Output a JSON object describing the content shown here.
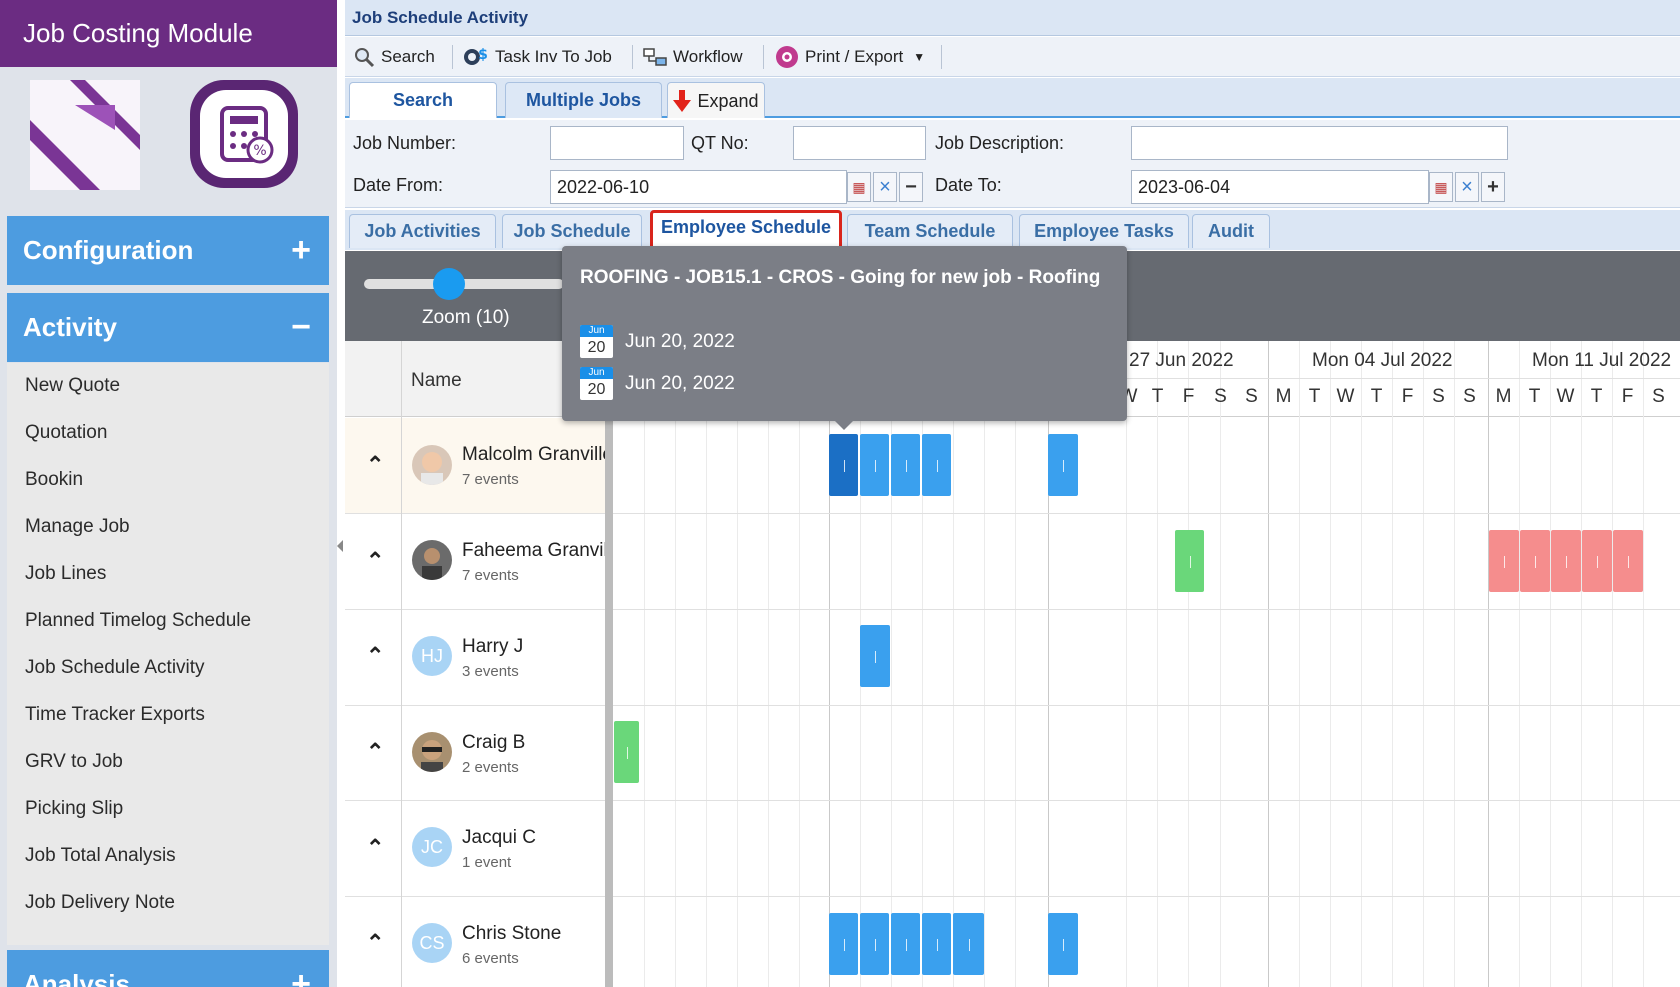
{
  "sidebar": {
    "module_title": "Job Costing Module",
    "sections": {
      "configuration": {
        "label": "Configuration",
        "sign": "+"
      },
      "activity": {
        "label": "Activity",
        "sign": "−"
      },
      "analysis": {
        "label": "Analysis",
        "sign": "+"
      }
    },
    "menu_items": [
      "New Quote",
      "Quotation",
      "Bookin",
      "Manage Job",
      "Job Lines",
      "Planned Timelog Schedule",
      "Job Schedule Activity",
      "Time Tracker Exports",
      "GRV to Job",
      "Picking Slip",
      "Job Total Analysis",
      "Job Delivery Note"
    ]
  },
  "page": {
    "title": "Job Schedule Activity"
  },
  "toolbar": {
    "search": "Search",
    "task_inv": "Task Inv To Job",
    "workflow": "Workflow",
    "print_export": "Print / Export"
  },
  "top_tabs": {
    "search": "Search",
    "multiple_jobs": "Multiple Jobs",
    "expand": "Expand"
  },
  "search_form": {
    "job_number_label": "Job Number:",
    "job_number_value": "",
    "qt_no_label": "QT No:",
    "qt_no_value": "",
    "job_description_label": "Job Description:",
    "job_description_value": "",
    "date_from_label": "Date From:",
    "date_from_value": "2022-06-10",
    "date_to_label": "Date To:",
    "date_to_value": "2023-06-04"
  },
  "view_tabs": {
    "job_activities": "Job Activities",
    "job_schedule": "Job Schedule",
    "employee_schedule": "Employee Schedule",
    "team_schedule": "Team Schedule",
    "employee_tasks": "Employee Tasks",
    "audit": "Audit",
    "active": "Employee Schedule"
  },
  "scheduler": {
    "zoom_label": "Zoom (10)",
    "zoom_value": 10,
    "name_header": "Name",
    "weeks": [
      "27 Jun 2022",
      "Mon 04 Jul 2022",
      "Mon 11 Jul 2022"
    ],
    "days": [
      "W",
      "T",
      "F",
      "S",
      "S",
      "M",
      "T",
      "W",
      "T",
      "F",
      "S",
      "S",
      "M",
      "T",
      "W",
      "T",
      "F",
      "S"
    ],
    "resources": [
      {
        "name": "Malcolm Granville",
        "count": "7 events",
        "initials": ""
      },
      {
        "name": "Faheema Granvill",
        "count": "7 events",
        "initials": ""
      },
      {
        "name": "Harry J",
        "count": "3 events",
        "initials": "HJ"
      },
      {
        "name": "Craig B",
        "count": "2 events",
        "initials": ""
      },
      {
        "name": "Jacqui C",
        "count": "1 event",
        "initials": "JC"
      },
      {
        "name": "Chris Stone",
        "count": "6 events",
        "initials": "CS"
      }
    ]
  },
  "tooltip": {
    "title": "ROOFING - JOB15.1 - CROS - Going for new job - Roofing",
    "start_month": "Jun",
    "start_day": "20",
    "start_date": "Jun 20, 2022",
    "end_month": "Jun",
    "end_day": "20",
    "end_date": "Jun 20, 2022"
  },
  "colors": {
    "module_header": "#6b2c82",
    "section_blue": "#4d9ce0",
    "event_blue": "#3aa0ee",
    "event_selected": "#1b6fc5",
    "event_green": "#6ad77a",
    "event_red": "#f58d8d",
    "active_tab_border": "#d9251c"
  }
}
